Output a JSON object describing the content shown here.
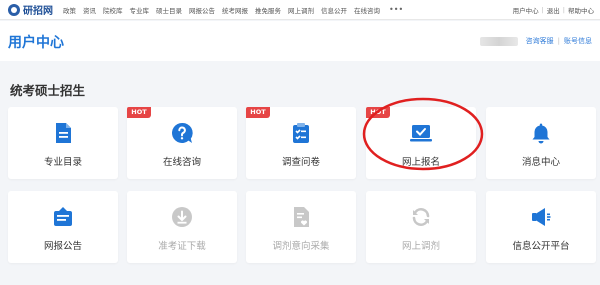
{
  "topnav": {
    "logo_text": "研招网",
    "links": [
      "政策",
      "资讯",
      "院校库",
      "专业库",
      "硕士目录",
      "网报公告",
      "统考网报",
      "推免服务",
      "网上调剂",
      "信息公开",
      "在线咨询"
    ],
    "more": "•••",
    "right": {
      "user_center": "用户中心",
      "logout": "退出",
      "help": "帮助中心",
      "sep": "|"
    }
  },
  "header": {
    "title": "用户中心",
    "consult_service": "咨询客服",
    "account_info": "账号信息",
    "sep": "|"
  },
  "section": {
    "title": "统考硕士招生",
    "hot_label": "HOT",
    "cards": [
      {
        "label": "专业目录",
        "icon": "catalog-doc-icon",
        "hot": false,
        "enabled": true
      },
      {
        "label": "在线咨询",
        "icon": "question-bubble-icon",
        "hot": true,
        "enabled": true
      },
      {
        "label": "调查问卷",
        "icon": "checklist-clipboard-icon",
        "hot": true,
        "enabled": true
      },
      {
        "label": "网上报名",
        "icon": "laptop-check-icon",
        "hot": true,
        "enabled": true
      },
      {
        "label": "消息中心",
        "icon": "bell-icon",
        "hot": false,
        "enabled": true
      },
      {
        "label": "网报公告",
        "icon": "announcement-briefcase-icon",
        "hot": false,
        "enabled": true
      },
      {
        "label": "准考证下载",
        "icon": "download-circle-icon",
        "hot": false,
        "enabled": false
      },
      {
        "label": "调剂意向采集",
        "icon": "document-heart-icon",
        "hot": false,
        "enabled": false
      },
      {
        "label": "网上调剂",
        "icon": "refresh-cycle-icon",
        "hot": false,
        "enabled": false
      },
      {
        "label": "信息公开平台",
        "icon": "megaphone-icon",
        "hot": false,
        "enabled": true
      }
    ]
  },
  "colors": {
    "accent": "#1f75d6",
    "hot": "#e64545",
    "disabled": "#c8c8c8",
    "annotation": "#e02020"
  }
}
